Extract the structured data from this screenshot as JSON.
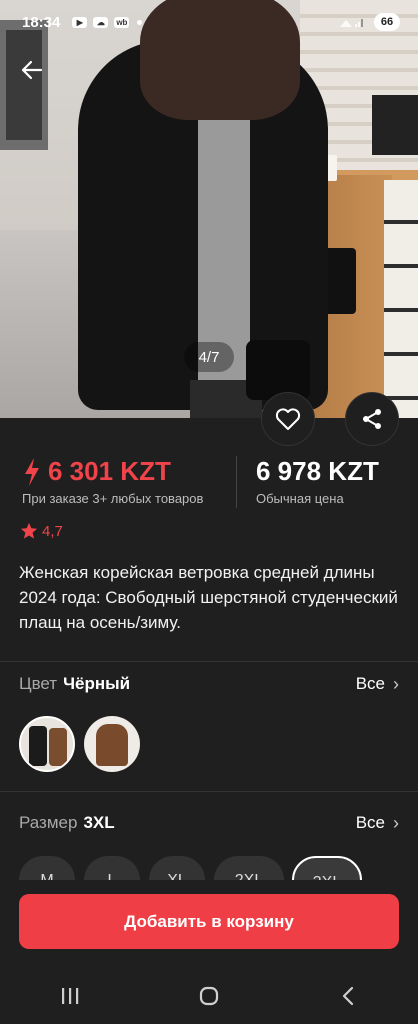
{
  "status_bar": {
    "time": "18:34",
    "wb_label": "wb",
    "battery": "66"
  },
  "gallery": {
    "counter": "4/7"
  },
  "price": {
    "promo": "6 301 KZT",
    "promo_note": "При заказе 3+ любых товаров",
    "regular": "6 978 KZT",
    "regular_note": "Обычная цена"
  },
  "rating": "4,7",
  "product_title": "Женская корейская ветровка средней длины 2024 года: Свободный шерстяной студенческий плащ на осень/зиму.",
  "color_option": {
    "label": "Цвет",
    "value": "Чёрный",
    "all": "Все"
  },
  "size_option": {
    "label": "Размер",
    "value": "3XL",
    "all": "Все"
  },
  "sizes": [
    "M",
    "L",
    "XL",
    "2XL",
    "3XL"
  ],
  "cta": "Добавить в корзину",
  "colors": {
    "accent": "#ef3e46",
    "background": "#1f1f1f"
  },
  "icons": [
    "back-arrow-icon",
    "heart-icon",
    "share-icon",
    "lightning-icon",
    "star-icon",
    "chevron-right-icon",
    "recents-icon",
    "home-icon",
    "back-nav-icon"
  ]
}
